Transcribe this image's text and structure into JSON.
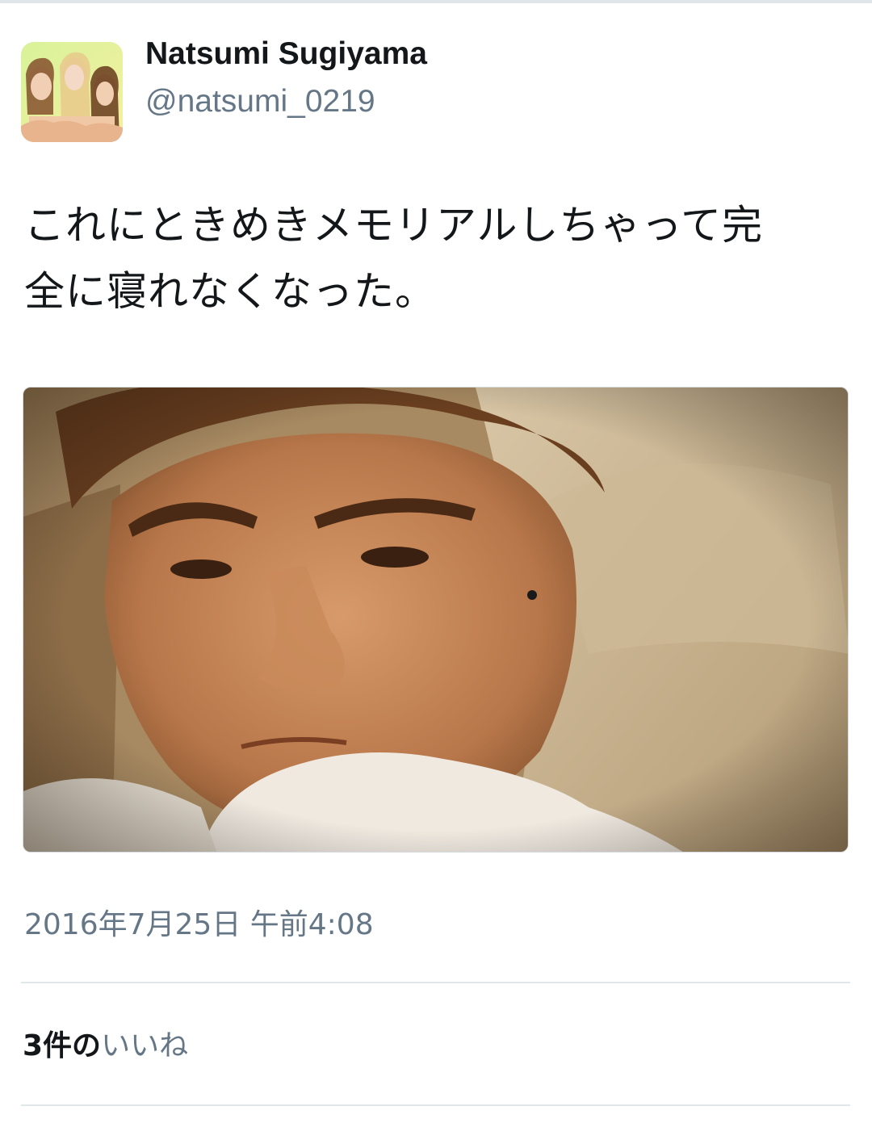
{
  "user": {
    "display_name": "Natsumi Sugiyama",
    "handle": "@natsumi_0219"
  },
  "tweet": {
    "text_line1": "これにときめきメモリアルしちゃって完",
    "text_line2": "全に寝れなくなった。",
    "timestamp": "2016年7月25日 午前4:08"
  },
  "stats": {
    "likes_count": "3件の",
    "likes_label": "いいね"
  },
  "colors": {
    "primary_text": "#14171a",
    "secondary_text": "#657786",
    "divider": "#e1e6ea"
  },
  "icons": {
    "avatar": "profile-avatar-image",
    "media": "tweet-photo"
  }
}
